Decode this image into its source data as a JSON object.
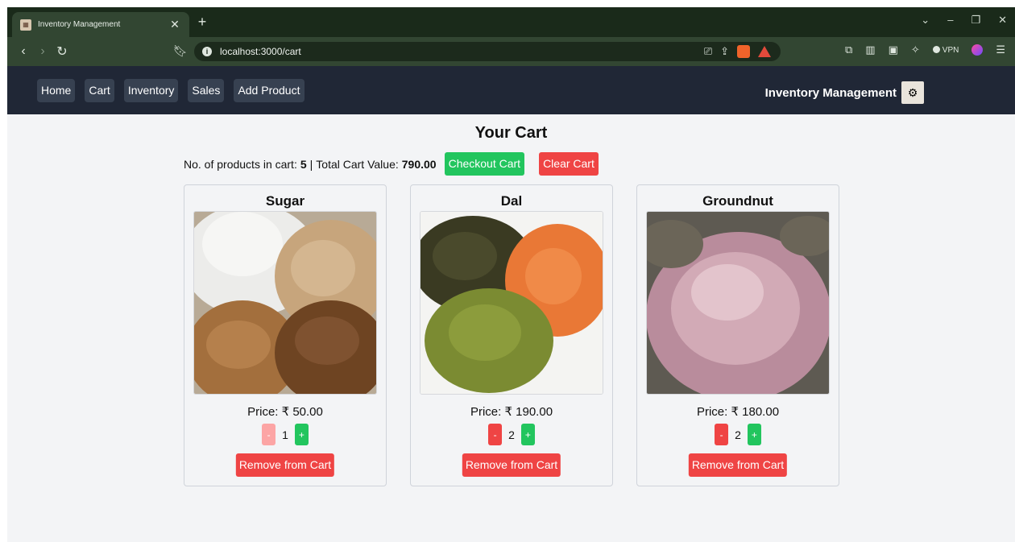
{
  "browser": {
    "tab_title": "Inventory Management",
    "tab_close": "✕",
    "new_tab": "+",
    "url": "localhost:3000/cart",
    "vpn_label": "VPN",
    "window_controls": [
      "⌄",
      "–",
      "❐",
      "✕"
    ]
  },
  "app": {
    "nav_links": [
      "Home",
      "Cart",
      "Inventory",
      "Sales",
      "Add Product"
    ],
    "brand_title": "Inventory Management"
  },
  "cart": {
    "title": "Your Cart",
    "count_label": "No. of products in cart:",
    "count_value": "5",
    "separator": "|",
    "total_label": "Total Cart Value:",
    "total_value": "790.00",
    "checkout_label": "Checkout Cart",
    "clear_label": "Clear Cart"
  },
  "products": [
    {
      "name": "Sugar",
      "price": "Price: ₹ 50.00",
      "quantity": "1",
      "minus": "-",
      "plus": "+",
      "remove": "Remove from Cart"
    },
    {
      "name": "Dal",
      "price": "Price: ₹ 190.00",
      "quantity": "2",
      "minus": "-",
      "plus": "+",
      "remove": "Remove from Cart"
    },
    {
      "name": "Groundnut",
      "price": "Price: ₹ 180.00",
      "quantity": "2",
      "minus": "-",
      "plus": "+",
      "remove": "Remove from Cart"
    }
  ],
  "colors": {
    "navbar": "#202736",
    "nav_button": "#374151",
    "success": "#22c55e",
    "danger": "#ef4444",
    "danger_disabled": "#fca5a5",
    "page_bg": "#f3f4f6"
  }
}
